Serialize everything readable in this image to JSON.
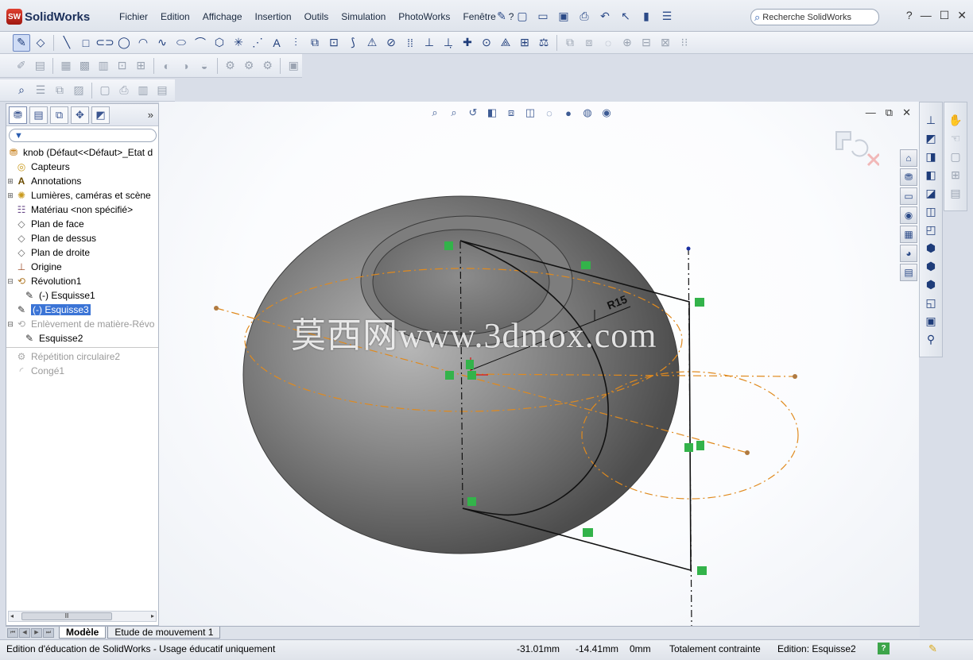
{
  "app": {
    "name": "SolidWorks",
    "badge": "SW"
  },
  "menu": [
    "Fichier",
    "Edition",
    "Affichage",
    "Insertion",
    "Outils",
    "Simulation",
    "PhotoWorks",
    "Fenêtre",
    "?"
  ],
  "search": {
    "placeholder": "Recherche SolidWorks"
  },
  "window_controls": [
    "?",
    "—",
    "☐",
    "✕"
  ],
  "feature_tree": {
    "root": "knob  (Défaut<<Défaut>_Etat d",
    "items": [
      {
        "label": "Capteurs",
        "icon": "sensor-icon"
      },
      {
        "label": "Annotations",
        "icon": "annotation-icon"
      },
      {
        "label": "Lumières, caméras et scène",
        "icon": "lights-icon"
      },
      {
        "label": "Matériau <non spécifié>",
        "icon": "material-icon"
      },
      {
        "label": "Plan de face",
        "icon": "plane-icon"
      },
      {
        "label": "Plan de dessus",
        "icon": "plane-icon"
      },
      {
        "label": "Plan de droite",
        "icon": "plane-icon"
      },
      {
        "label": "Origine",
        "icon": "origin-icon"
      },
      {
        "label": "Révolution1",
        "icon": "revolve-icon"
      },
      {
        "label": "(-) Esquisse1",
        "icon": "sketch-icon"
      },
      {
        "label": "(-) Esquisse3",
        "icon": "sketch-icon",
        "selected": true
      },
      {
        "label": "Enlèvement de matière-Révo",
        "icon": "cut-revolve-icon",
        "suppressed": true
      },
      {
        "label": "Esquisse2",
        "icon": "sketch-icon"
      },
      {
        "label": "Répétition circulaire2",
        "icon": "pattern-icon",
        "suppressed": true
      },
      {
        "label": "Congé1",
        "icon": "fillet-icon",
        "suppressed": true
      }
    ]
  },
  "graphics": {
    "watermark": "莫西网www.3dmox.com",
    "dimension": "R15"
  },
  "bottom_tabs": [
    "Modèle",
    "Etude de mouvement 1"
  ],
  "status": {
    "message": "Edition d'éducation de SolidWorks - Usage éducatif uniquement",
    "x": "-31.01mm",
    "y": "-14.41mm",
    "z": "0mm",
    "state": "Totalement contrainte",
    "editing": "Edition: Esquisse2"
  },
  "colors": {
    "accent": "#3b74d6",
    "sketch_line": "#000000",
    "construction": "#e08a1e",
    "relation": "#33b34a"
  }
}
